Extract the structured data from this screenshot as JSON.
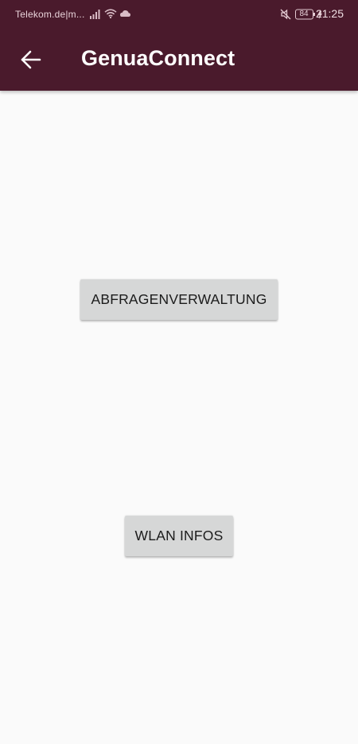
{
  "status_bar": {
    "carrier": "Telekom.de|m...",
    "battery_percent": "84",
    "time": "21:25",
    "icons": [
      "signal-icon",
      "wifi-icon",
      "cloud-icon",
      "mute-icon",
      "battery-icon",
      "charging-icon"
    ]
  },
  "app_bar": {
    "title": "GenuaConnect",
    "back_icon": "arrow-left-icon",
    "background_color": "#4a1a2c"
  },
  "main": {
    "buttons": [
      {
        "label": "ABFRAGENVERWALTUNG"
      },
      {
        "label": "WLAN INFOS"
      }
    ],
    "button_color": "#d6d7d7",
    "background_color": "#fafafa"
  }
}
